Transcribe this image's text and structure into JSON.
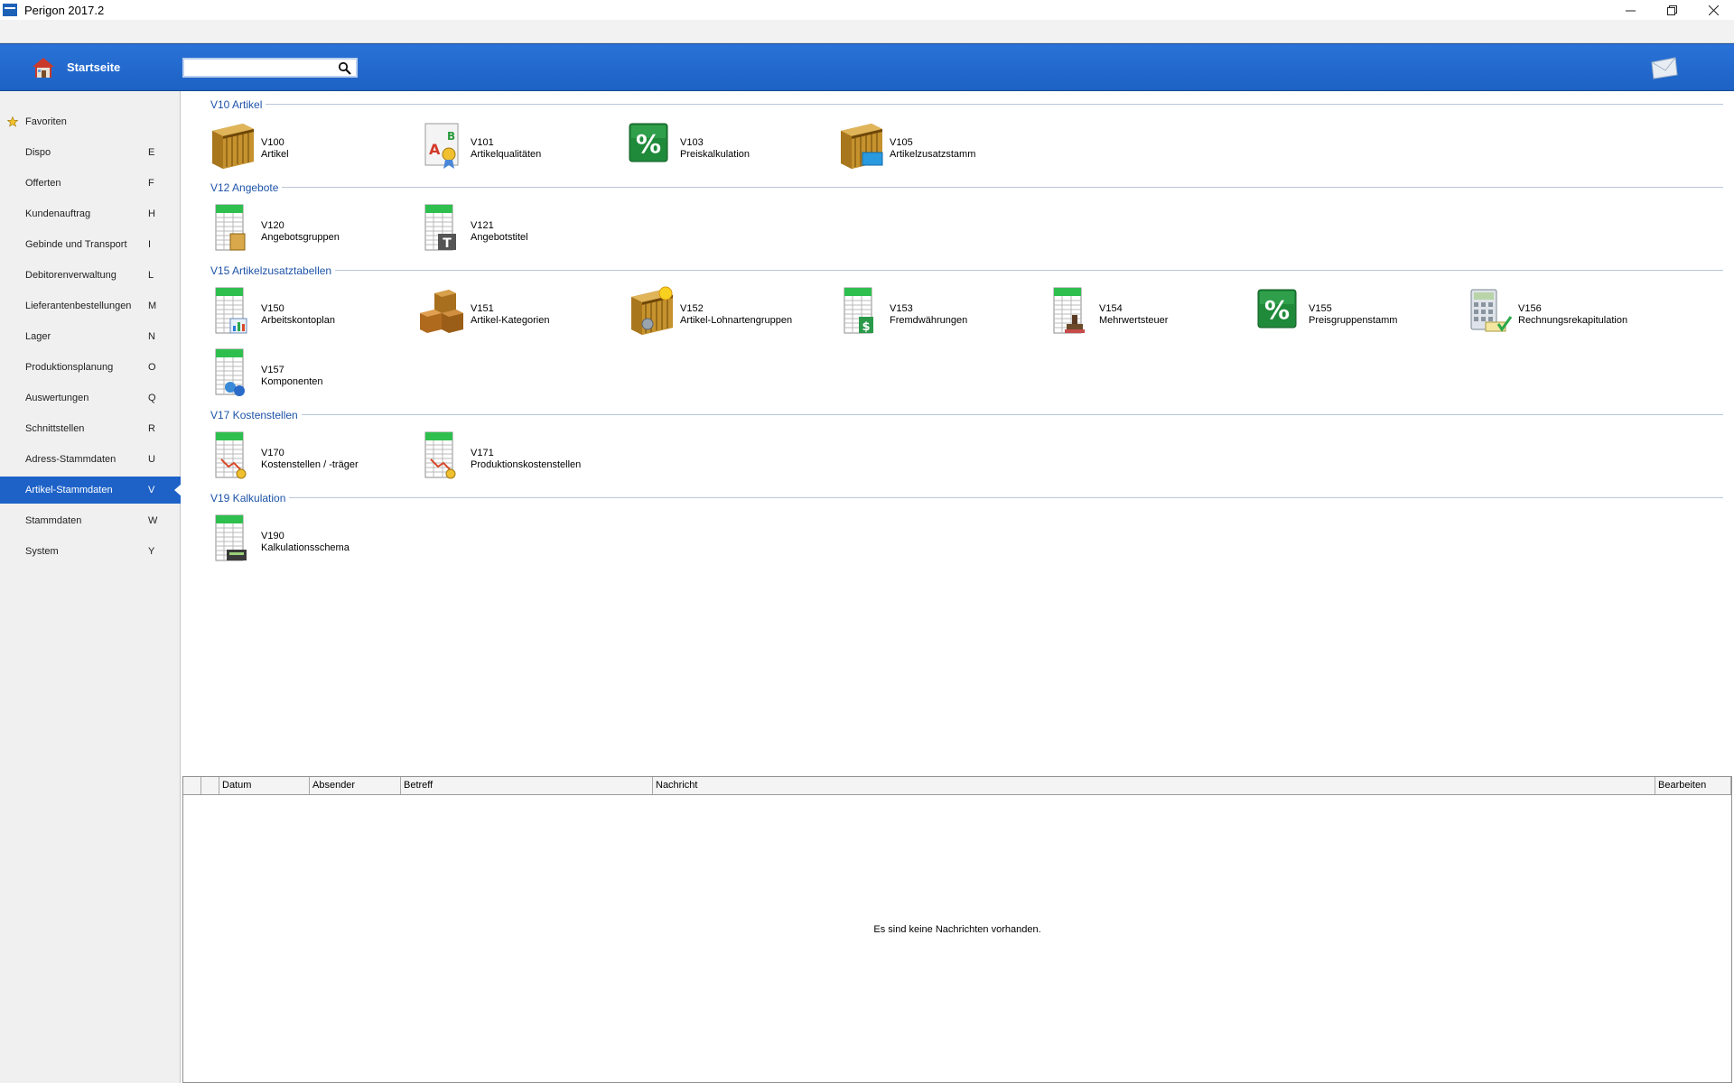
{
  "window": {
    "title": "Perigon 2017.2"
  },
  "header": {
    "home_label": "Startseite",
    "search": {
      "value": "",
      "placeholder": ""
    }
  },
  "sidebar": {
    "items": [
      {
        "label": "Favoriten",
        "key": "",
        "icon": "star-icon"
      },
      {
        "label": "Dispo",
        "key": "E"
      },
      {
        "label": "Offerten",
        "key": "F"
      },
      {
        "label": "Kundenauftrag",
        "key": "H"
      },
      {
        "label": "Gebinde und Transport",
        "key": "I"
      },
      {
        "label": "Debitorenverwaltung",
        "key": "L"
      },
      {
        "label": "Lieferantenbestellungen",
        "key": "M"
      },
      {
        "label": "Lager",
        "key": "N"
      },
      {
        "label": "Produktionsplanung",
        "key": "O"
      },
      {
        "label": "Auswertungen",
        "key": "Q"
      },
      {
        "label": "Schnittstellen",
        "key": "R"
      },
      {
        "label": "Adress-Stammdaten",
        "key": "U"
      },
      {
        "label": "Artikel-Stammdaten",
        "key": "V",
        "active": true
      },
      {
        "label": "Stammdaten",
        "key": "W"
      },
      {
        "label": "System",
        "key": "Y"
      }
    ]
  },
  "sections": [
    {
      "title": "V10 Artikel",
      "tiles": [
        {
          "code": "V100",
          "name": "Artikel",
          "icon": "crate-icon"
        },
        {
          "code": "V101",
          "name": "Artikelqualitäten",
          "icon": "quality-certificate-icon"
        },
        {
          "code": "V103",
          "name": "Preiskalkulation",
          "icon": "percent-calculation-icon"
        },
        {
          "code": "V105",
          "name": "Artikelzusatzstamm",
          "icon": "crate-extra-icon"
        }
      ]
    },
    {
      "title": "V12 Angebote",
      "tiles": [
        {
          "code": "V120",
          "name": "Angebotsgruppen",
          "icon": "spreadsheet-group-icon"
        },
        {
          "code": "V121",
          "name": "Angebotstitel",
          "icon": "spreadsheet-title-icon"
        }
      ]
    },
    {
      "title": "V15 Artikelzusatztabellen",
      "tiles": [
        {
          "code": "V150",
          "name": "Arbeitskontoplan",
          "icon": "spreadsheet-chart-icon"
        },
        {
          "code": "V151",
          "name": "Artikel-Kategorien",
          "icon": "boxes-icon"
        },
        {
          "code": "V152",
          "name": "Artikel-Lohnartengruppen",
          "icon": "crate-sun-icon"
        },
        {
          "code": "V153",
          "name": "Fremdwährungen",
          "icon": "spreadsheet-dollar-icon"
        },
        {
          "code": "V154",
          "name": "Mehrwertsteuer",
          "icon": "spreadsheet-stamp-icon"
        },
        {
          "code": "V155",
          "name": "Preisgruppenstamm",
          "icon": "percent-icon"
        },
        {
          "code": "V156",
          "name": "Rechnungsrekapitulation",
          "icon": "calculator-icon"
        },
        {
          "code": "V157",
          "name": "Komponenten",
          "icon": "spreadsheet-components-icon"
        }
      ]
    },
    {
      "title": "V17 Kostenstellen",
      "tiles": [
        {
          "code": "V170",
          "name": "Kostenstellen / -träger",
          "icon": "spreadsheet-cost-icon"
        },
        {
          "code": "V171",
          "name": "Produktionskostenstellen",
          "icon": "spreadsheet-production-icon"
        }
      ]
    },
    {
      "title": "V19 Kalkulation",
      "tiles": [
        {
          "code": "V190",
          "name": "Kalkulationsschema",
          "icon": "spreadsheet-calc-icon"
        }
      ]
    }
  ],
  "messages": {
    "columns": [
      "",
      "",
      "Datum",
      "Absender",
      "Betreff",
      "Nachricht",
      "Bearbeiten"
    ],
    "empty_text": "Es sind keine Nachrichten vorhanden."
  },
  "colors": {
    "accent": "#1e62c8",
    "section_title": "#1d53a8",
    "sheet_green": "#2fbf4f",
    "crate": "#b8892c"
  }
}
